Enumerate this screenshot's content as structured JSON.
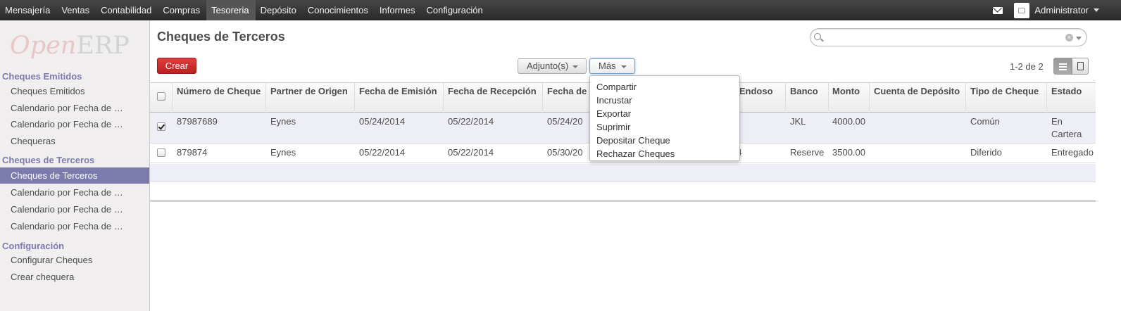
{
  "topbar": {
    "menu": [
      {
        "label": "Mensajería",
        "active": false
      },
      {
        "label": "Ventas",
        "active": false
      },
      {
        "label": "Contabilidad",
        "active": false
      },
      {
        "label": "Compras",
        "active": false
      },
      {
        "label": "Tesoreria",
        "active": true
      },
      {
        "label": "Depósito",
        "active": false
      },
      {
        "label": "Conocimientos",
        "active": false
      },
      {
        "label": "Informes",
        "active": false
      },
      {
        "label": "Configuración",
        "active": false
      }
    ],
    "user": "Administrator"
  },
  "logo": {
    "open": "Open",
    "erp": "ERP"
  },
  "sidebar": {
    "sections": [
      {
        "title": "Cheques Emitidos",
        "items": [
          "Cheques Emitidos",
          "Calendario por Fecha de …",
          "Calendario por Fecha de …",
          "Chequeras"
        ]
      },
      {
        "title": "Cheques de Terceros",
        "items": [
          "Cheques de Terceros",
          "Calendario por Fecha de …",
          "Calendario por Fecha de …",
          "Calendario por Fecha de …"
        ]
      },
      {
        "title": "Configuración",
        "items": [
          "Configurar Cheques",
          "Crear chequera"
        ]
      }
    ],
    "active_item": "Cheques de Terceros"
  },
  "main": {
    "title": "Cheques de Terceros",
    "search": {
      "placeholder": "",
      "value": ""
    },
    "create_label": "Crear",
    "attachments_label": "Adjunto(s)",
    "more_label": "Más",
    "pager": "1-2 de 2"
  },
  "table": {
    "columns": [
      "Número de Cheque",
      "Partner de Origen",
      "Fecha de Emisión",
      "Fecha de Recepción",
      "Fecha de",
      "e Endoso",
      "Banco",
      "Monto",
      "Cuenta de Depósito",
      "Tipo de Cheque",
      "Estado"
    ],
    "rows": [
      {
        "checked": true,
        "cells": [
          "87987689",
          "Eynes",
          "05/24/2014",
          "05/22/2014",
          "05/24/20",
          "",
          "JKL",
          "4000.00",
          "",
          "Común",
          "En Cartera"
        ]
      },
      {
        "checked": false,
        "cells": [
          "879874",
          "Eynes",
          "05/22/2014",
          "05/22/2014",
          "05/30/20",
          "14",
          "Reserve",
          "3500.00",
          "",
          "Diferido",
          "Entregado"
        ]
      }
    ]
  },
  "more_menu": {
    "items": [
      "Compartir",
      "Incrustar",
      "Exportar",
      "Suprimir",
      "Depositar Cheque",
      "Rechazar Cheques"
    ]
  },
  "colors": {
    "topbar": "#3c3c3c",
    "sidebar_accent": "#7c7bad",
    "create_button": "#c72a2a"
  }
}
